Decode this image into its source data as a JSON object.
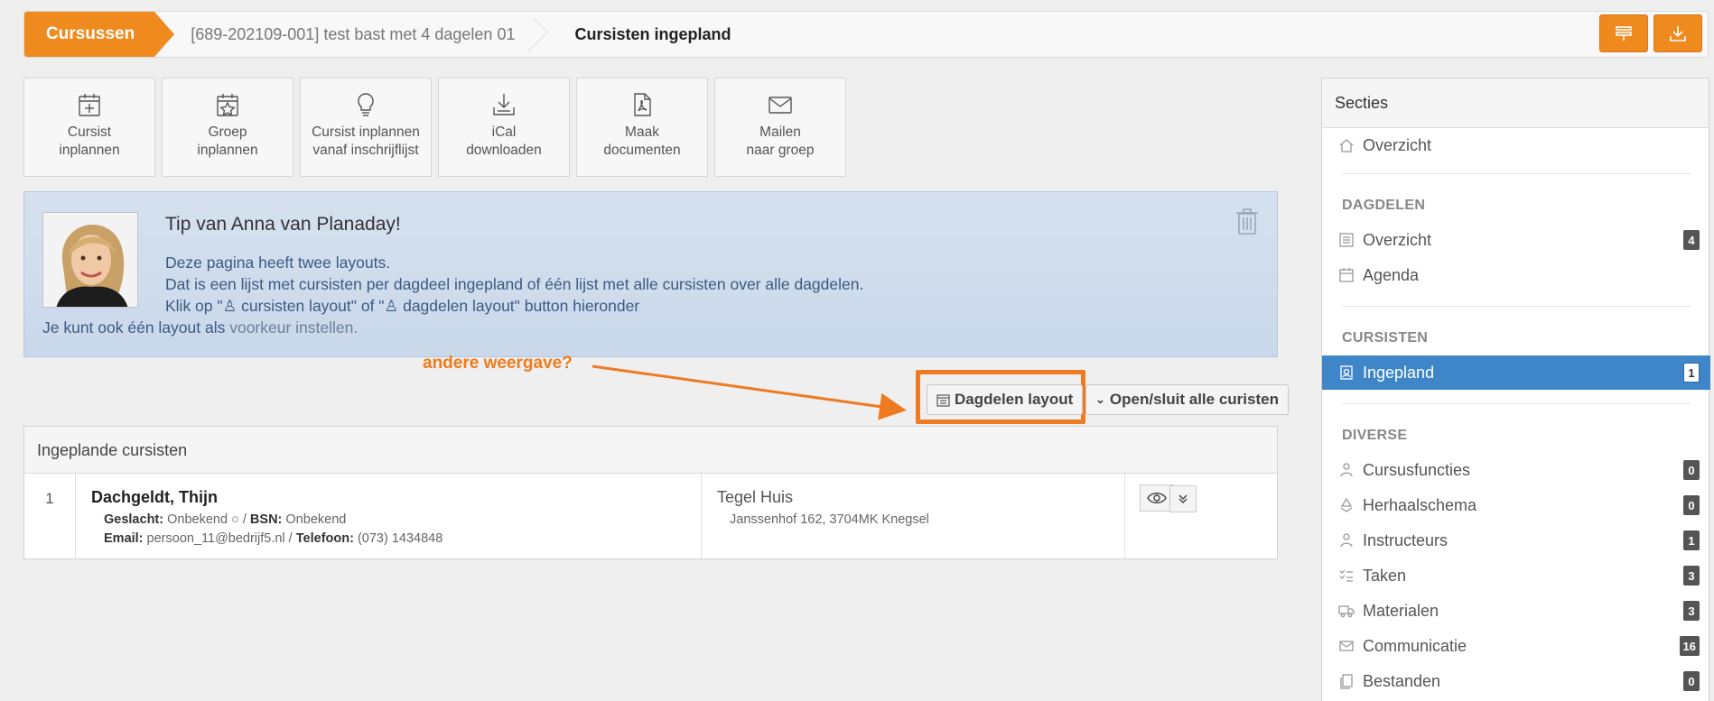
{
  "breadcrumb": {
    "home": "Cursussen",
    "course": "[689-202109-001] test bast met 4 dagelen 01",
    "current": "Cursisten ingepland"
  },
  "tiles": [
    {
      "icon": "calendar-plus-icon",
      "line1": "Cursist",
      "line2": "inplannen"
    },
    {
      "icon": "calendar-star-icon",
      "line1": "Groep",
      "line2": "inplannen"
    },
    {
      "icon": "lightbulb-icon",
      "line1": "Cursist inplannen",
      "line2": "vanaf inschrijflijst"
    },
    {
      "icon": "download-icon",
      "line1": "iCal",
      "line2": "downloaden"
    },
    {
      "icon": "pdf-file-icon",
      "line1": "Maak",
      "line2": "documenten"
    },
    {
      "icon": "envelope-icon",
      "line1": "Mailen",
      "line2": "naar groep"
    }
  ],
  "tip": {
    "title": "Tip van Anna van Planaday!",
    "line1": "Deze pagina heeft twee layouts.",
    "line2": "Dat is een lijst met cursisten per dagdeel ingepland of één lijst met alle cursisten over alle dagdelen.",
    "line3_a": "Klik op \"",
    "line3_b": " cursisten layout\" of \"",
    "line3_c": " dagdelen layout\" button hieronder",
    "line4_a": "Je kunt ook één layout als ",
    "line4_link": "voorkeur instellen."
  },
  "annotation": "andere weergave?",
  "buttons": {
    "dagdelen_layout": "Dagdelen layout",
    "toggle_all": "Open/sluit alle curisten"
  },
  "table": {
    "title": "Ingeplande cursisten",
    "rows": [
      {
        "num": "1",
        "name": "Dachgeldt, Thijn",
        "gender_label": "Geslacht:",
        "gender": "Onbekend",
        "bsn_label": "BSN:",
        "bsn": "Onbekend",
        "email_label": "Email:",
        "email": "persoon_11@bedrijf5.nl",
        "phone_label": "Telefoon:",
        "phone": "(073) 1434848",
        "company": "Tegel Huis",
        "address": "Janssenhof 162, 3704MK Knegsel"
      }
    ]
  },
  "sidebar": {
    "title": "Secties",
    "overview": "Overzicht",
    "sections": {
      "dagdelen": "DAGDELEN",
      "cursisten": "CURSISTEN",
      "diverse": "DIVERSE"
    },
    "dagdelen_items": [
      {
        "label": "Overzicht",
        "count": "4"
      },
      {
        "label": "Agenda",
        "count": ""
      }
    ],
    "cursisten_items": [
      {
        "label": "Ingepland",
        "count": "1"
      }
    ],
    "diverse_items": [
      {
        "label": "Cursusfuncties",
        "count": "0"
      },
      {
        "label": "Herhaalschema",
        "count": "0"
      },
      {
        "label": "Instructeurs",
        "count": "1"
      },
      {
        "label": "Taken",
        "count": "3"
      },
      {
        "label": "Materialen",
        "count": "3"
      },
      {
        "label": "Communicatie",
        "count": "16"
      },
      {
        "label": "Bestanden",
        "count": "0"
      }
    ]
  },
  "colors": {
    "accent": "#ef8a1f",
    "active": "#3f86c9",
    "annotation": "#ee7a22"
  }
}
